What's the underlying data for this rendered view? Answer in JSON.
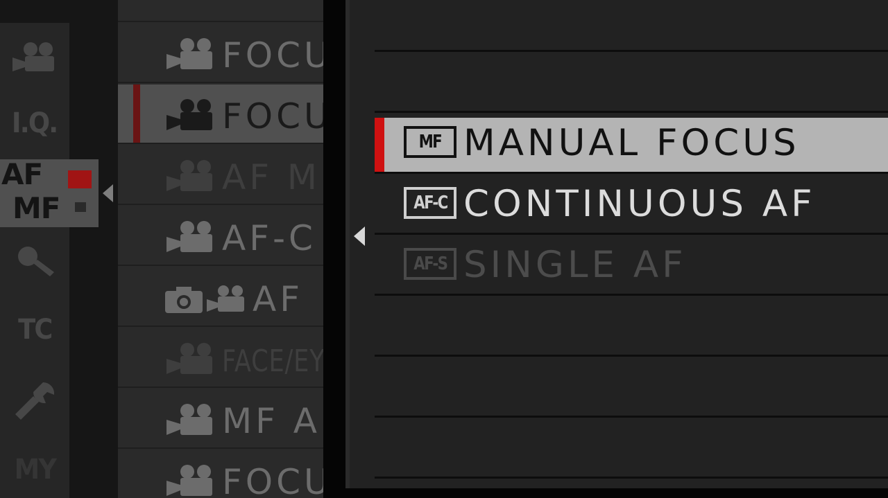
{
  "tabs": {
    "iq": "I.Q.",
    "af_mf_top": "AF",
    "af_mf_bottom": "MF",
    "tc": "TC",
    "my": "MY"
  },
  "menu": {
    "items": [
      {
        "label": "FOCU",
        "icon": "movie-camera-icon",
        "state": "normal"
      },
      {
        "label": "FOCU",
        "icon": "movie-camera-icon",
        "state": "selected"
      },
      {
        "label": "AF M",
        "icon": "movie-camera-icon",
        "state": "disabled"
      },
      {
        "label": "AF-C C",
        "icon": "movie-camera-icon",
        "state": "normal"
      },
      {
        "label": "AF",
        "icon": "still-and-movie-camera-icon",
        "state": "normal"
      },
      {
        "label": "FACE/EYE",
        "icon": "movie-camera-icon",
        "state": "disabled"
      },
      {
        "label": "MF A",
        "icon": "movie-camera-icon",
        "state": "normal"
      },
      {
        "label": "FOCU",
        "icon": "movie-camera-icon",
        "state": "normal"
      }
    ]
  },
  "submenu": {
    "options": [
      {
        "badge": "MF",
        "label": "MANUAL FOCUS",
        "state": "selected"
      },
      {
        "badge": "AF-C",
        "label": "CONTINUOUS AF",
        "state": "normal"
      },
      {
        "badge": "AF-S",
        "label": "SINGLE AF",
        "state": "disabled"
      }
    ]
  },
  "colors": {
    "selection_accent": "#cf1111",
    "panel_background": "#222222",
    "selected_row": "#b4b4b4"
  }
}
